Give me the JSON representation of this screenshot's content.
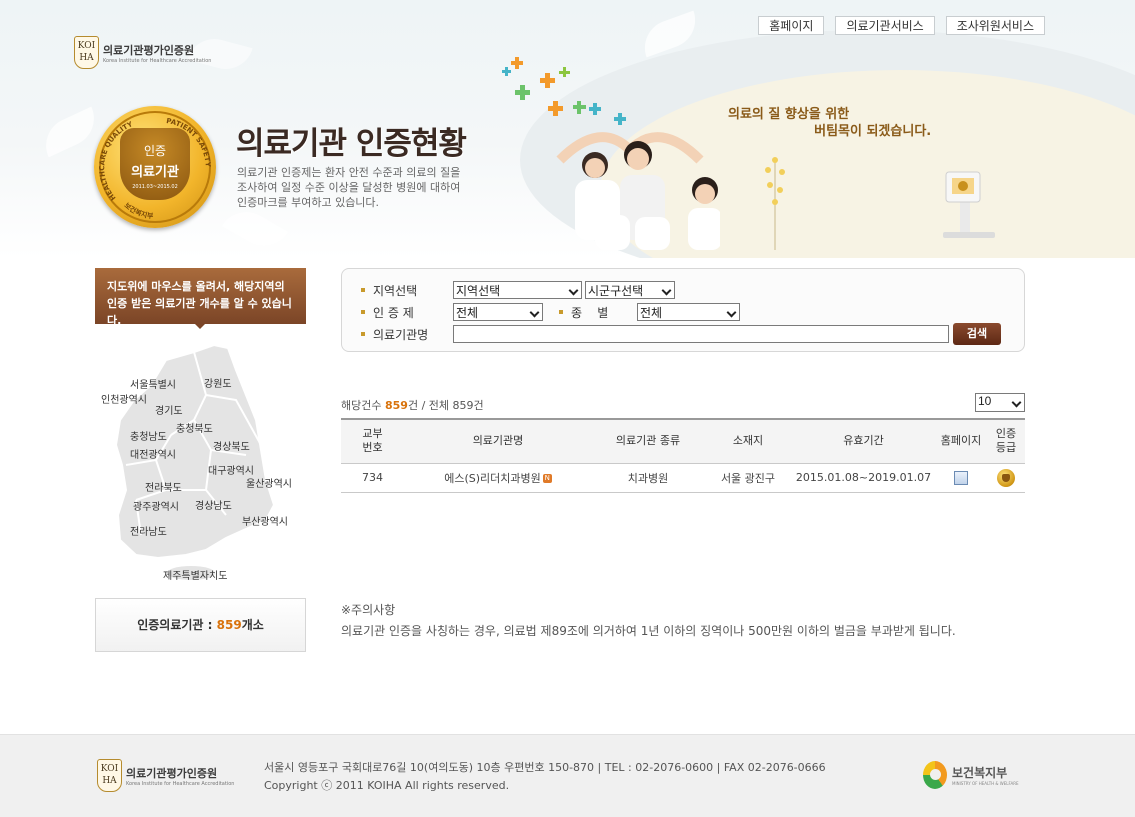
{
  "top_nav": [
    "홈페이지",
    "의료기관서비스",
    "조사위원서비스"
  ],
  "logo": {
    "mark": "KOI HA",
    "name_ko": "의료기관평가인증원",
    "name_en": "Korea Institute for Healthcare Accreditation"
  },
  "badge": {
    "line1": "인증",
    "line2": "의료기관",
    "period": "2011.03~2015.02",
    "ring_left": "HEALTHCARE QUALITY",
    "ring_right": "PATIENT SAFETY",
    "ring_bottom": "보건복지부"
  },
  "hero": {
    "title": "의료기관 인증현황",
    "description": "의료기관 인증제는 환자 안전 수준과 의료의 질을\n조사하여 일정 수준 이상을 달성한 병원에 대하여\n인증마크를 부여하고 있습니다.",
    "slogan_line1": "의료의 질 향상을 위한",
    "slogan_line2": "버팀목이 되겠습니다."
  },
  "map": {
    "guide_line1": "지도위에 마우스를 올려서, 해당지역의",
    "guide_line2": "인증 받은 의료기관 개수를 알 수 있습니다.",
    "regions": [
      "서울특별시",
      "강원도",
      "인천광역시",
      "경기도",
      "충청북도",
      "충청남도",
      "경상북도",
      "대전광역시",
      "대구광역시",
      "전라북도",
      "울산광역시",
      "광주광역시",
      "경상남도",
      "부산광역시",
      "전라남도",
      "제주특별자치도"
    ],
    "stat_label": "인증의료기관 :",
    "stat_count": "859",
    "stat_unit": "개소"
  },
  "search": {
    "region_label": "지역선택",
    "region_value": "지역선택",
    "city_value": "시군구선택",
    "cert_label": "인 증 제",
    "cert_value": "전체",
    "type_label": "종    별",
    "type_value": "전체",
    "name_label": "의료기관명",
    "name_value": "",
    "button": "검색"
  },
  "results": {
    "count_label": "해당건수",
    "count_value": "859",
    "count_unit": "건",
    "total_text": "/ 전체 859건",
    "page_size": "10"
  },
  "table": {
    "headers": [
      "교부\n번호",
      "의료기관명",
      "의료기관 종류",
      "소재지",
      "유효기간",
      "홈페이지",
      "인증\n등급"
    ],
    "rows": [
      {
        "no": "734",
        "name": "에스(S)리더치과병원",
        "new_badge": "N",
        "kind": "치과병원",
        "location": "서울 광진구",
        "period": "2015.01.08~2019.01.07"
      }
    ]
  },
  "notice": {
    "title": "※주의사항",
    "text": "의료기관 인증을 사칭하는 경우, 의료법 제89조에 의거하여 1년 이하의 징역이나 500만원 이하의 벌금을 부과받게 됩니다."
  },
  "footer": {
    "address": "서울시 영등포구 국회대로76길 10(여의도동) 10층 우편번호 150-870 | TEL : 02-2076-0600 | FAX 02-2076-0666",
    "copyright": "Copyright ⓒ 2011 KOIHA All rights reserved.",
    "ministry": "보건복지부",
    "ministry_en": "MINISTRY OF HEALTH & WELFARE"
  },
  "colors": {
    "accent_orange": "#d9730c",
    "brown": "#7b4527",
    "gold": "#f2b52b"
  }
}
